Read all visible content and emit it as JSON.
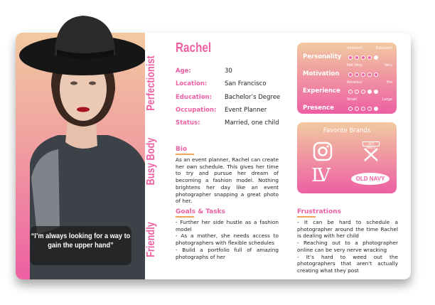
{
  "persona": {
    "name": "Rachel",
    "quote": "“I’m always looking for a way to gain the upper hand”",
    "traits": [
      "Perfectionist",
      "Busy Body",
      "Friendly"
    ],
    "details": [
      {
        "label": "Age:",
        "value": "30"
      },
      {
        "label": "Location:",
        "value": "San Francisco"
      },
      {
        "label": "Education:",
        "value": "Bachelor’s Degree"
      },
      {
        "label": "Occupation:",
        "value": "Event Planner"
      },
      {
        "label": "Status:",
        "value": "Married, one child"
      }
    ]
  },
  "bio": {
    "heading": "Bio",
    "text": "As an event planner, Rachel can create her own schedule. This gives her time to try and pursue her dream of becoming a fashion model. Nothing brightens her day like an event photographer snapping a great photo of her."
  },
  "goals": {
    "heading": "Goals & Tasks",
    "items": [
      "- Further her side hustle as a fashion model",
      "- As a mother, she needs access to photographers with flexible schedules",
      "- Build a portfolio full of amazing photographs of her"
    ]
  },
  "frustrations": {
    "heading": "Frustrations",
    "items": [
      "- It can be hard to schedule a photographer around the time Rachel is dealing with her child",
      "- Reaching out to a photographer online can be very nerve wracking",
      "- It’s hard to weed out the photographers that aren’t actually creating what they post"
    ]
  },
  "scales": [
    {
      "label": "Personality",
      "low": "Introvert",
      "high": "Extrovert",
      "dots": [
        "pink",
        "pink",
        "pink",
        "pink",
        "white"
      ]
    },
    {
      "label": "Motivation",
      "low": "Not Very",
      "high": "Very",
      "dots": [
        "pink",
        "pink",
        "pink",
        "pink",
        "pink"
      ]
    },
    {
      "label": "Experience",
      "low": "Amateur",
      "high": "Pro",
      "dots": [
        "empty",
        "empty",
        "empty",
        "white",
        "white"
      ]
    },
    {
      "label": "Presence",
      "low": "Small",
      "high": "Large",
      "dots": [
        "empty",
        "empty",
        "empty",
        "empty",
        "white"
      ]
    }
  ],
  "brands": {
    "heading": "Favorite Brands",
    "items": [
      {
        "icon": "instagram-icon"
      },
      {
        "icon": "off-white-icon",
        "text": "OFF WHITE"
      },
      {
        "icon": "louis-vuitton-icon",
        "text": "LV"
      },
      {
        "icon": "old-navy-icon",
        "text": "OLD NAVY"
      }
    ]
  },
  "colors": {
    "accent": "#ee5fa3",
    "underline": "#f5a35c",
    "gradient_top": "#f1c9a0"
  }
}
